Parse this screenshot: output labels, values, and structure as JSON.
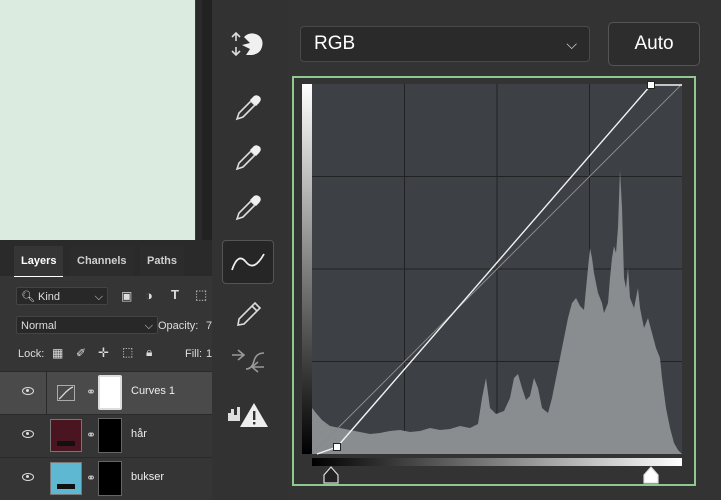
{
  "layers_panel": {
    "tabs": [
      "Layers",
      "Channels",
      "Paths"
    ],
    "filter_kind": "Kind",
    "blend_mode": "Normal",
    "opacity_label": "Opacity:",
    "opacity_value": "7",
    "lock_label": "Lock:",
    "fill_label": "Fill:",
    "fill_value": "1",
    "layers": [
      {
        "name": "Curves 1",
        "selected": true
      },
      {
        "name": "hår",
        "selected": false
      },
      {
        "name": "bukser",
        "selected": false
      }
    ]
  },
  "properties": {
    "channel": "RGB",
    "auto_label": "Auto"
  },
  "colors": {
    "canvas": "#dcebe0",
    "focus_ring": "#8fc98f",
    "layer_har_thumb": "#4a1420",
    "layer_bukser_thumb": "#5fb8d2"
  }
}
